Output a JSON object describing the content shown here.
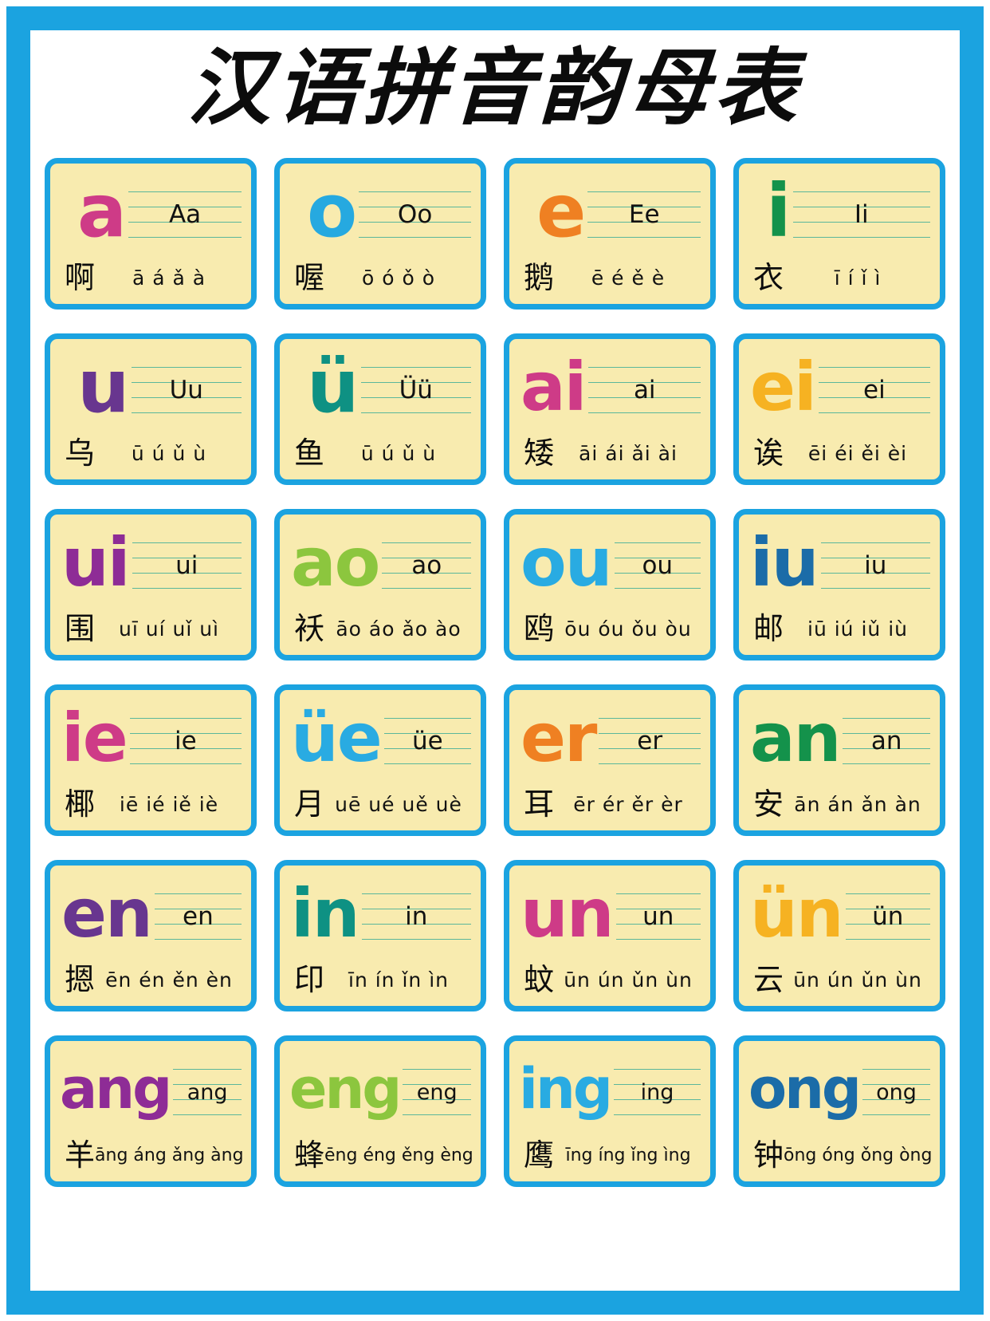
{
  "poster": {
    "title": "汉语拼音韵母表",
    "frame_color": "#1BA3E0",
    "card_bg_color": "#F8EBAF",
    "guide_line_color": "#5BB79B"
  },
  "cards": [
    {
      "letter": "a",
      "small": "Aa",
      "hanzi": "啊",
      "tones": "ā á ǎ à",
      "color": "#CE3B87"
    },
    {
      "letter": "o",
      "small": "Oo",
      "hanzi": "喔",
      "tones": "ō ó ǒ ò",
      "color": "#26A9E0"
    },
    {
      "letter": "e",
      "small": "Ee",
      "hanzi": "鹅",
      "tones": "ē é ě è",
      "color": "#EF8022"
    },
    {
      "letter": "i",
      "small": "Ii",
      "hanzi": "衣",
      "tones": "ī í ǐ ì",
      "color": "#14924B"
    },
    {
      "letter": "u",
      "small": "Uu",
      "hanzi": "乌",
      "tones": "ū ú ǔ ù",
      "color": "#68368F"
    },
    {
      "letter": "ü",
      "small": "Üü",
      "hanzi": "鱼",
      "tones": "ū ú ǔ ù",
      "color": "#0E9183"
    },
    {
      "letter": "ai",
      "small": "ai",
      "hanzi": "矮",
      "tones": "āi ái ǎi ài",
      "color": "#CE3B87"
    },
    {
      "letter": "ei",
      "small": "ei",
      "hanzi": "诶",
      "tones": "ēi éi ěi èi",
      "color": "#F6B222"
    },
    {
      "letter": "ui",
      "small": "ui",
      "hanzi": "围",
      "tones": "uī uí uǐ uì",
      "color": "#8E2C96"
    },
    {
      "letter": "ao",
      "small": "ao",
      "hanzi": "袄",
      "tones": "āo áo ǎo ào",
      "color": "#8CC63E"
    },
    {
      "letter": "ou",
      "small": "ou",
      "hanzi": "鸥",
      "tones": "ōu óu ǒu òu",
      "color": "#29ABE2"
    },
    {
      "letter": "iu",
      "small": "iu",
      "hanzi": "邮",
      "tones": "iū iú iǔ iù",
      "color": "#1B6CA8"
    },
    {
      "letter": "ie",
      "small": "ie",
      "hanzi": "椰",
      "tones": "iē ié iě iè",
      "color": "#CE3B87"
    },
    {
      "letter": "üe",
      "small": "üe",
      "hanzi": "月",
      "tones": "uē ué uě uè",
      "color": "#29ABE2"
    },
    {
      "letter": "er",
      "small": "er",
      "hanzi": "耳",
      "tones": "ēr ér ěr èr",
      "color": "#EF8022"
    },
    {
      "letter": "an",
      "small": "an",
      "hanzi": "安",
      "tones": "ān án ǎn àn",
      "color": "#14924B"
    },
    {
      "letter": "en",
      "small": "en",
      "hanzi": "摁",
      "tones": "ēn én ěn èn",
      "color": "#68368F"
    },
    {
      "letter": "in",
      "small": "in",
      "hanzi": "印",
      "tones": "īn ín ǐn ìn",
      "color": "#0E9183"
    },
    {
      "letter": "un",
      "small": "un",
      "hanzi": "蚊",
      "tones": "ūn ún ǔn ùn",
      "color": "#CE3B87"
    },
    {
      "letter": "ün",
      "small": "ün",
      "hanzi": "云",
      "tones": "ūn ún ǔn ùn",
      "color": "#F6B222"
    },
    {
      "letter": "ang",
      "small": "ang",
      "hanzi": "羊",
      "tones": "āng áng ǎng àng",
      "color": "#8E2C96"
    },
    {
      "letter": "eng",
      "small": "eng",
      "hanzi": "蜂",
      "tones": "ēng éng ěng èng",
      "color": "#8CC63E"
    },
    {
      "letter": "ing",
      "small": "ing",
      "hanzi": "鹰",
      "tones": "īng íng ǐng ìng",
      "color": "#29ABE2"
    },
    {
      "letter": "ong",
      "small": "ong",
      "hanzi": "钟",
      "tones": "ōng óng ǒng òng",
      "color": "#1B6CA8"
    }
  ]
}
